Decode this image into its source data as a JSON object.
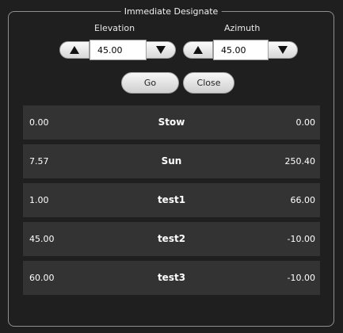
{
  "panel": {
    "title": "Immediate Designate"
  },
  "elevation": {
    "label": "Elevation",
    "value": "45.00"
  },
  "azimuth": {
    "label": "Azimuth",
    "value": "45.00"
  },
  "actions": {
    "go_label": "Go",
    "close_label": "Close"
  },
  "targets": [
    {
      "elevation": "0.00",
      "name": "Stow",
      "azimuth": "0.00"
    },
    {
      "elevation": "7.57",
      "name": "Sun",
      "azimuth": "250.40"
    },
    {
      "elevation": "1.00",
      "name": "test1",
      "azimuth": "66.00"
    },
    {
      "elevation": "45.00",
      "name": "test2",
      "azimuth": "-10.00"
    },
    {
      "elevation": "60.00",
      "name": "test3",
      "azimuth": "-10.00"
    }
  ],
  "icons": {
    "increment": "triangle-up-icon",
    "decrement": "triangle-down-icon"
  },
  "colors": {
    "background": "#1f1f1f",
    "row_background": "#333333",
    "text": "#ffffff"
  }
}
